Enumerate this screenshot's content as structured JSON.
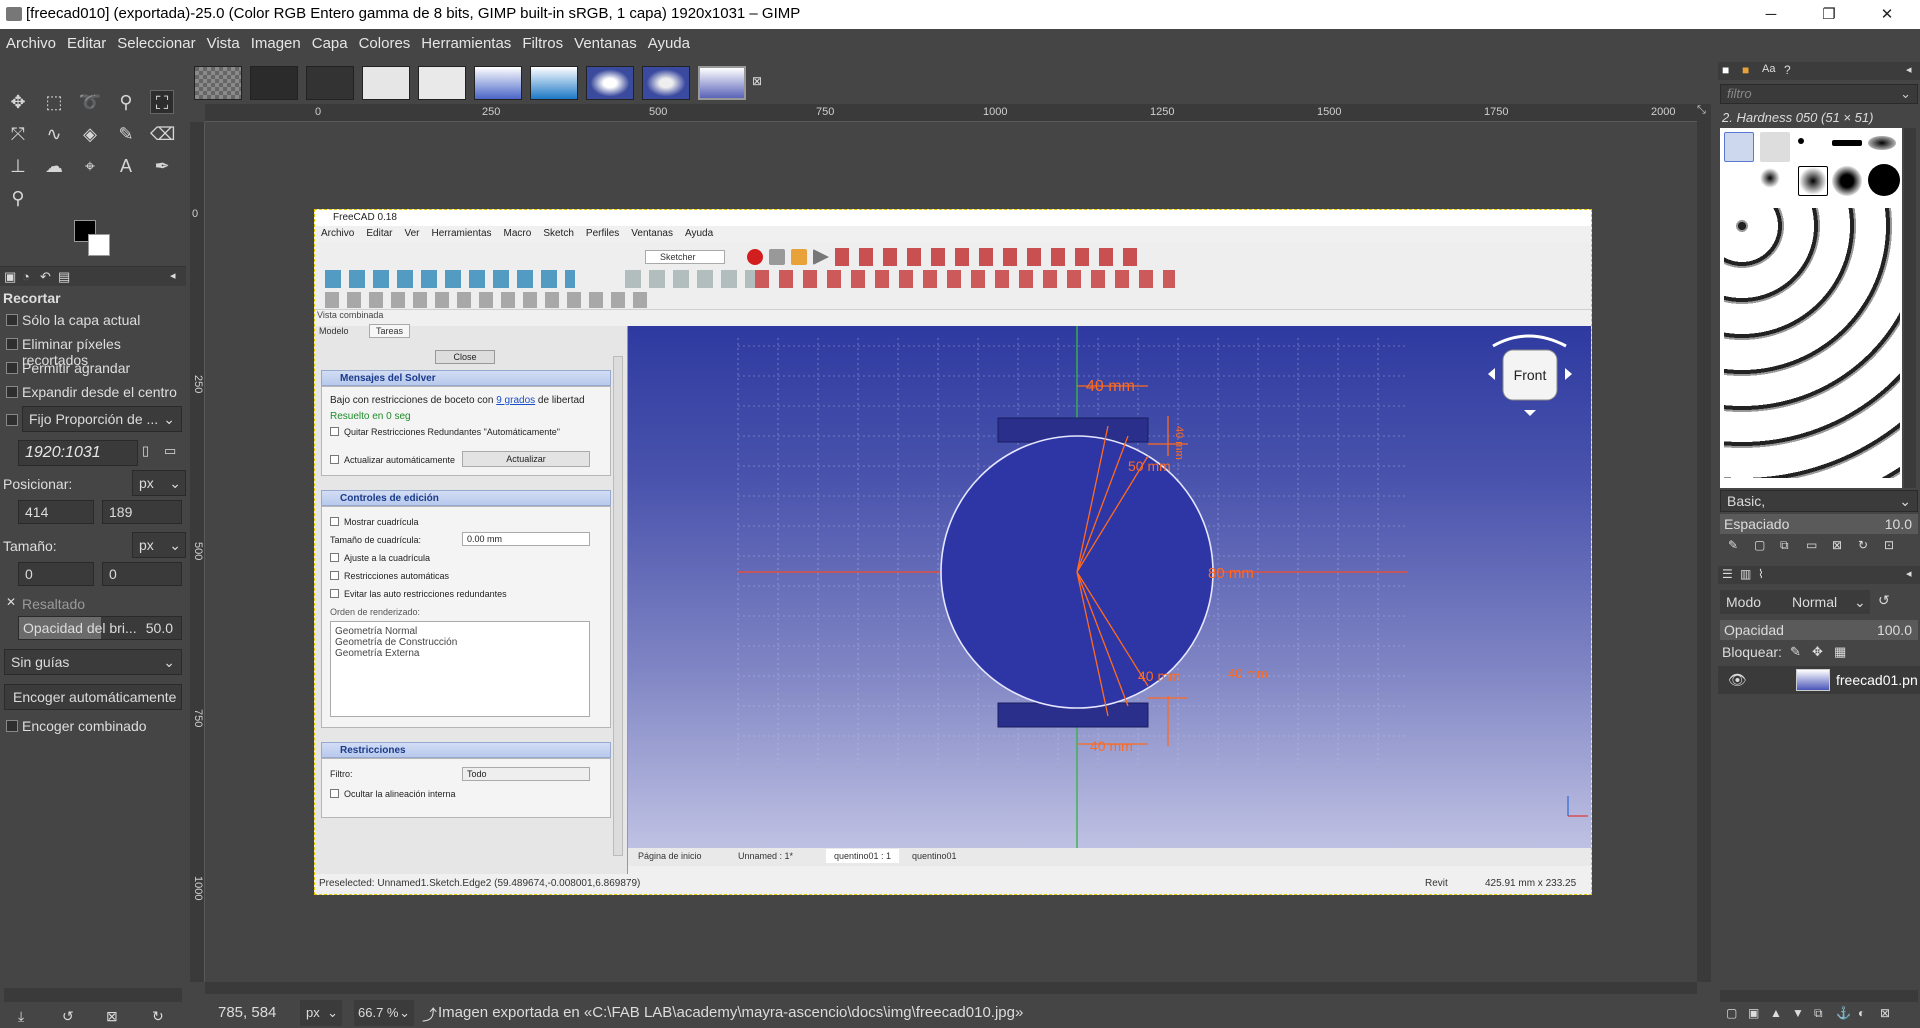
{
  "window": {
    "title": "[freecad010] (exportada)-25.0 (Color RGB Entero gamma de 8 bits, GIMP built-in sRGB, 1 capa) 1920x1031 – GIMP",
    "minimize": "─",
    "maximize": "❐",
    "close": "✕"
  },
  "menu": [
    "Archivo",
    "Editar",
    "Seleccionar",
    "Vista",
    "Imagen",
    "Capa",
    "Colores",
    "Herramientas",
    "Filtros",
    "Ventanas",
    "Ayuda"
  ],
  "tool_options": {
    "title": "Recortar",
    "only_current_layer": "Sólo la capa actual",
    "delete_cropped": "Eliminar píxeles recortados",
    "allow_growing": "Permitir agrandar",
    "expand_center": "Expandir desde el centro",
    "fixed_ratio": "Fijo Proporción de ...",
    "ratio_value": "1920:1031",
    "position_label": "Posicionar:",
    "position_unit": "px",
    "pos_x": "414",
    "pos_y": "189",
    "size_label": "Tamaño:",
    "size_unit": "px",
    "size_w": "0",
    "size_h": "0",
    "highlight": "Resaltado",
    "highlight_opacity_label": "Opacidad del bri...",
    "highlight_opacity_value": "50.0",
    "guides": "Sin guías",
    "auto_shrink": "Encoger automáticamente",
    "shrink_merged": "Encoger combinado"
  },
  "rulers": {
    "h": [
      "0",
      "250",
      "500",
      "750",
      "1000",
      "1250",
      "1500",
      "1750",
      "2000"
    ],
    "v": [
      "0",
      "250",
      "500",
      "750",
      "1000"
    ]
  },
  "freecad": {
    "title": "FreeCAD 0.18",
    "menu": [
      "Archivo",
      "Editar",
      "Ver",
      "Herramientas",
      "Macro",
      "Sketch",
      "Perfiles",
      "Ventanas",
      "Ayuda"
    ],
    "workbench": "Sketcher",
    "panel_title": "Vista combinada",
    "tab_model": "Modelo",
    "tab_tasks": "Tareas",
    "close_btn": "Close",
    "solver_head": "Mensajes del Solver",
    "solver_text1": "Bajo con restricciones de boceto con",
    "solver_link": "9 grados",
    "solver_text2": "de libertad",
    "solver_ok": "Resuelto en 0 seg",
    "remove_redundant": "Quitar Restricciones Redundantes \"Automáticamente\"",
    "auto_update": "Actualizar automáticamente",
    "update_btn": "Actualizar",
    "edit_head": "Controles de edición",
    "show_grid": "Mostrar cuadrícula",
    "grid_size_label": "Tamaño de cuadrícula:",
    "grid_size_value": "0.00 mm",
    "snap_grid": "Ajuste a la cuadrícula",
    "auto_constraints": "Restricciones automáticas",
    "avoid_redundant": "Evitar las auto restricciones redundantes",
    "render_order": "Orden de renderizado:",
    "render_items": [
      "Geometría Normal",
      "Geometría de Construcción",
      "Geometría Externa"
    ],
    "constraints_head": "Restricciones",
    "filter_label": "Filtro:",
    "filter_value": "Todo",
    "hide_internal": "Ocultar la alineación interna",
    "nav_cube": "Front",
    "dims": [
      "40 mm",
      "50 mm",
      "40 mm",
      "40 mm",
      "80 mm",
      "40 mm",
      "40 mm"
    ],
    "tabs": [
      "Página de inicio",
      "Unnamed : 1*",
      "quentino01 : 1",
      "quentino01"
    ],
    "status_left": "Preselected: Unnamed1.Sketch.Edge2 (59.489674,-0.008001,6.869879)",
    "status_nav": "Revit",
    "status_dims": "425.91 mm x 233.25 mm"
  },
  "brushes": {
    "filter_placeholder": "filtro",
    "selected": "2. Hardness 050 (51 × 51)",
    "preset": "Basic,",
    "spacing_label": "Espaciado",
    "spacing_value": "10.0"
  },
  "layers": {
    "mode_label": "Modo",
    "mode_value": "Normal",
    "opacity_label": "Opacidad",
    "opacity_value": "100.0",
    "lock_label": "Bloquear:",
    "layer_name": "freecad01.pn"
  },
  "status": {
    "coords": "785, 584",
    "unit": "px",
    "zoom": "66.7 %",
    "message": "Imagen exportada en «C:\\FAB LAB\\academy\\mayra-ascencio\\docs\\img\\freecad010.jpg»"
  },
  "colors": {
    "gimp_bg": "#454545",
    "accent": "#e8772e",
    "selection": "#e0c800"
  }
}
